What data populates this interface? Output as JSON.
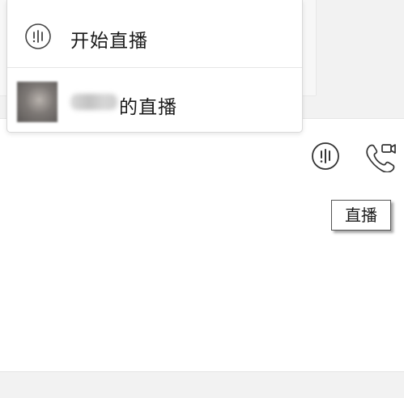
{
  "menu": {
    "items": [
      {
        "label": "开始直播",
        "icon": "live-icon"
      },
      {
        "label": "的直播",
        "icon": "avatar"
      }
    ]
  },
  "toolbar": {
    "buttons": [
      {
        "icon": "live-icon"
      },
      {
        "icon": "video-call-icon"
      }
    ]
  },
  "tooltip": {
    "text": "直播"
  },
  "colors": {
    "icon_stroke": "#333333",
    "menu_bg": "#ffffff",
    "panel_bg": "#f2f2f2"
  }
}
